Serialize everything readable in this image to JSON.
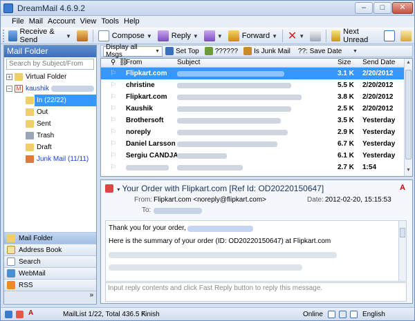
{
  "window": {
    "title": "DreamMail 4.6.9.2"
  },
  "menu": [
    "File",
    "Mail",
    "Account",
    "View",
    "Tools",
    "Help"
  ],
  "toolbar": {
    "receive_send": "Receive & Send",
    "compose": "Compose",
    "reply": "Reply",
    "forward": "Forward",
    "next_unread": "Next Unread"
  },
  "left_panel": {
    "header": "Mail Folder",
    "search_placeholder": "Search by Subject/From",
    "tree": {
      "virtual_folder": "Virtual Folder",
      "account": "kaushik",
      "inbox": "In (22/22)",
      "out": "Out",
      "sent": "Sent",
      "trash": "Trash",
      "draft": "Draft",
      "junk": "Junk Mail (11/11)"
    },
    "nav": [
      "Mail Folder",
      "Address Book",
      "Search",
      "WebMail",
      "RSS"
    ]
  },
  "filterbar": {
    "view_option": "Display all Msgs",
    "set_top": "Set Top",
    "unknown_btn": "??????",
    "is_junk": "Is Junk Mail",
    "sort_label": "??: Save Date"
  },
  "message_list": {
    "columns": {
      "from": "From",
      "subject": "Subject",
      "size": "Size",
      "send_date": "Send Date"
    },
    "rows": [
      {
        "from": "Flipkart.com",
        "size": "3.1 K",
        "date": "2/20/2012",
        "selected": true
      },
      {
        "from": "christine",
        "size": "5.5 K",
        "date": "2/20/2012",
        "selected": false
      },
      {
        "from": "Flipkart.com",
        "size": "3.8 K",
        "date": "2/20/2012",
        "selected": false
      },
      {
        "from": "Kaushik",
        "size": "2.5 K",
        "date": "2/20/2012",
        "selected": false
      },
      {
        "from": "Brothersoft",
        "size": "3.5 K",
        "date": "Yesterday",
        "selected": false
      },
      {
        "from": "noreply",
        "size": "2.9 K",
        "date": "Yesterday",
        "selected": false
      },
      {
        "from": "Daniel Larsson",
        "size": "6.7 K",
        "date": "Yesterday",
        "selected": false
      },
      {
        "from": "Sergiu CANDJA",
        "size": "6.1 K",
        "date": "Yesterday",
        "selected": false
      },
      {
        "from": "",
        "size": "2.7 K",
        "date": "1:54",
        "selected": false
      }
    ]
  },
  "preview": {
    "subject": "Your Order with Flipkart.com [Ref Id: OD20220150647]",
    "from_label": "From:",
    "from_value": "Flipkart.com <noreply@flipkart.com>",
    "to_label": "To:",
    "date_label": "Date:",
    "date_value": "2012-02-20, 15:15:53",
    "body_greeting": "Thank you for your order,",
    "body_summary": "Here is the summary of your order (ID: OD20220150647) at Flipkart.com",
    "reply_placeholder": "Input reply contents and click Fast Reply button to reply this message."
  },
  "statusbar": {
    "mail_list": "MailList 1/22, Total 436.5 K",
    "state": "Finish",
    "online": "Online",
    "language": "English"
  }
}
